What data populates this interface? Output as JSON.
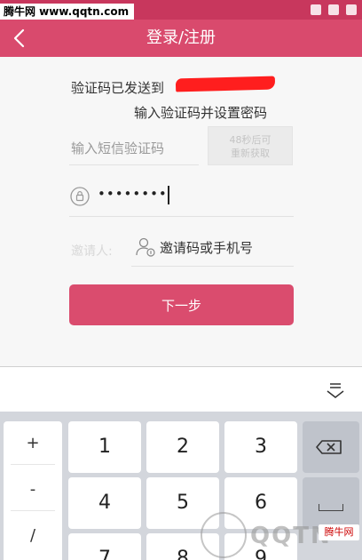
{
  "statusbar": {
    "site_watermark": "腾牛网 www.qqtn.com"
  },
  "header": {
    "title": "登录/注册"
  },
  "form": {
    "sent_text": "验证码已发送到",
    "instruction": "输入验证码并设置密码",
    "code_placeholder": "输入短信验证码",
    "resend_line1": "48秒后可",
    "resend_line2": "重新获取",
    "password_masked": "••••••••",
    "inviter_label": "邀请人:",
    "invite_placeholder": "邀请码或手机号",
    "next_button": "下一步"
  },
  "keyboard": {
    "symbols": [
      "+",
      "-",
      "/"
    ],
    "row1": [
      "1",
      "2",
      "3"
    ],
    "row2": [
      "4",
      "5",
      "6"
    ],
    "row3": [
      "7",
      "8",
      "9"
    ]
  },
  "watermark": {
    "logo_text": "QQTN",
    "badge": "腾牛网"
  },
  "colors": {
    "accent": "#da4c6e",
    "header": "#d94a6d",
    "status": "#c8375d",
    "keyboard_bg": "#d3d6dc"
  }
}
